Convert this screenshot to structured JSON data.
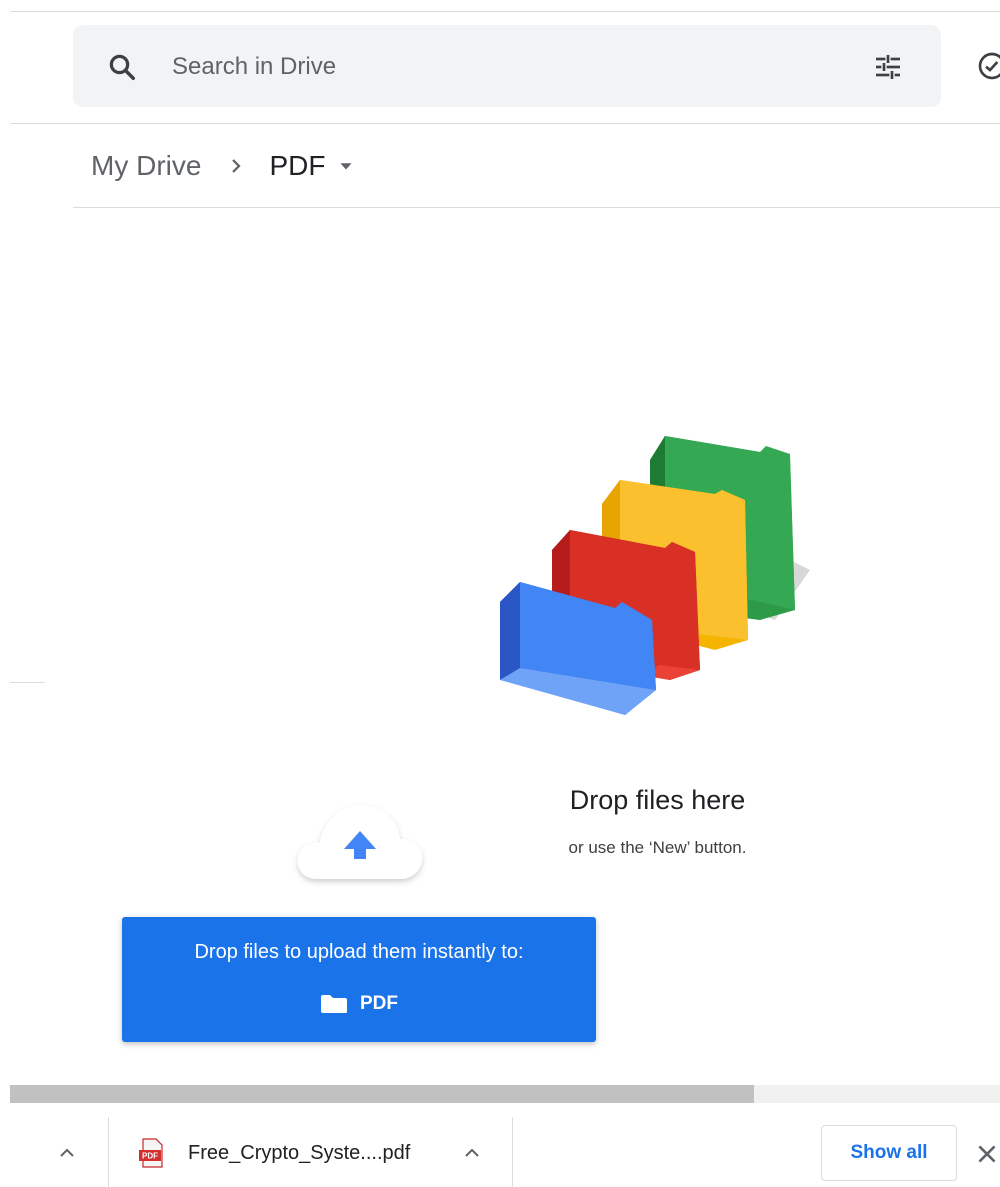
{
  "search": {
    "placeholder": "Search in Drive",
    "icons": [
      "search-icon",
      "tune-icon",
      "offline-status-icon"
    ]
  },
  "breadcrumb": {
    "root": "My Drive",
    "current": "PDF"
  },
  "empty_state": {
    "title": "Drop files here",
    "subtitle": "or use the ‘New’ button."
  },
  "upload_banner": {
    "text": "Drop files to upload them instantly to:",
    "target": "PDF"
  },
  "download_shelf": {
    "filename": "Free_Crypto_Syste....pdf",
    "show_all_label": "Show all"
  },
  "colors": {
    "accent": "#1a73e8",
    "folder_blue": "#4285f4",
    "folder_red": "#ea4335",
    "folder_yellow": "#fbbc04",
    "folder_green": "#34a853"
  }
}
